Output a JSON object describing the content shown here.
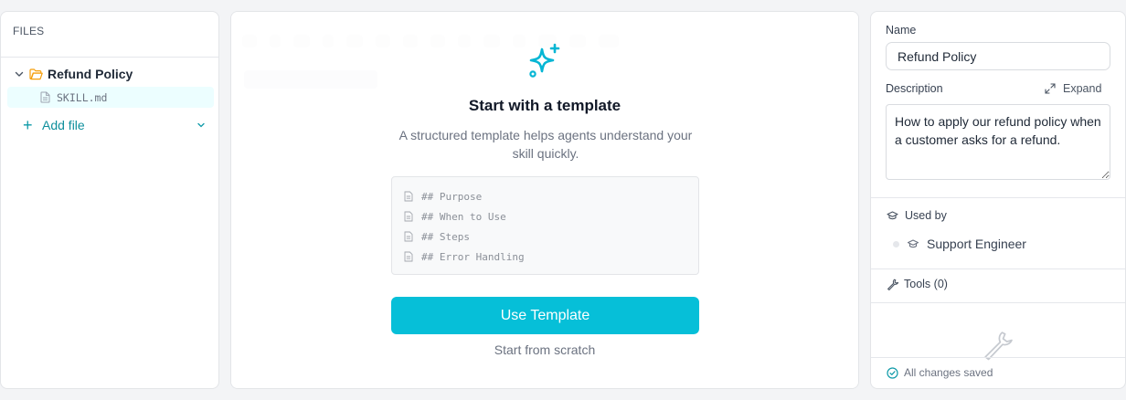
{
  "files": {
    "title": "FILES",
    "folder": {
      "name": "Refund Policy",
      "expanded": true,
      "icon": "folder-open-icon",
      "color": "#f59e0b"
    },
    "items": [
      {
        "name": "SKILL.md",
        "icon": "file-icon",
        "selected": true
      }
    ],
    "add_label": "Add file"
  },
  "editor": {
    "empty_state": {
      "icon": "sparkles-icon",
      "title": "Start with a template",
      "description": "A structured template helps agents understand your skill quickly.",
      "template_lines": [
        "## Purpose",
        "## When to Use",
        "## Steps",
        "## Error Handling"
      ],
      "primary_button": "Use Template",
      "secondary_link": "Start from scratch"
    }
  },
  "properties": {
    "name_label": "Name",
    "name_value": "Refund Policy",
    "description_label": "Description",
    "expand_label": "Expand",
    "description_value": "How to apply our refund policy when a customer asks for a refund.",
    "used_by_label": "Used by",
    "used_by": [
      {
        "name": "Support Engineer",
        "icon": "graduation-cap-icon"
      }
    ],
    "tools_label": "Tools (0)",
    "save_status": "All changes saved"
  },
  "colors": {
    "accent": "#06bfd8",
    "accent_dark": "#0e8f9c",
    "folder": "#f59e0b"
  }
}
